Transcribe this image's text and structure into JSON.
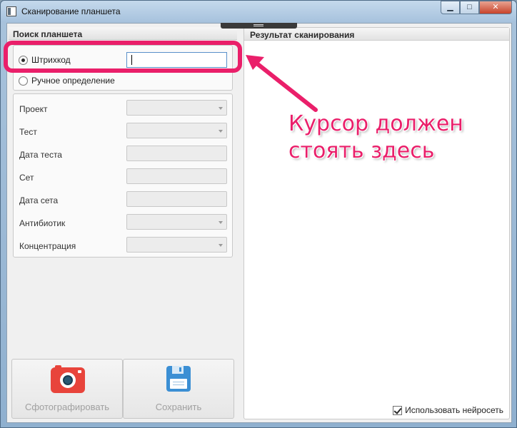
{
  "window": {
    "title": "Сканирование планшета",
    "minimize_glyph": "▁",
    "maximize_glyph": "□",
    "close_glyph": "✕"
  },
  "left_panel": {
    "header": "Поиск планшета",
    "mode_options": [
      {
        "label": "Штрихкод",
        "selected": true
      },
      {
        "label": "Ручное определение",
        "selected": false
      }
    ],
    "barcode_input": {
      "value": "",
      "placeholder": ""
    },
    "fields": [
      {
        "label": "Проект",
        "kind": "combo",
        "value": ""
      },
      {
        "label": "Тест",
        "kind": "combo",
        "value": ""
      },
      {
        "label": "Дата теста",
        "kind": "text",
        "value": ""
      },
      {
        "label": "Сет",
        "kind": "text",
        "value": ""
      },
      {
        "label": "Дата сета",
        "kind": "text",
        "value": ""
      },
      {
        "label": "Антибиотик",
        "kind": "combo",
        "value": ""
      },
      {
        "label": "Концентрация",
        "kind": "combo",
        "value": ""
      }
    ],
    "buttons": {
      "photo_label": "Сфотографировать",
      "photo_icon": "camera-icon",
      "save_label": "Сохранить",
      "save_icon": "floppy-disk-icon"
    }
  },
  "right_panel": {
    "header": "Результат сканирования",
    "use_neural_net": {
      "label": "Использовать нейросеть",
      "checked": true
    }
  },
  "annotation": {
    "text": "Курсор должен стоять здесь",
    "color": "#ea1f6a"
  }
}
